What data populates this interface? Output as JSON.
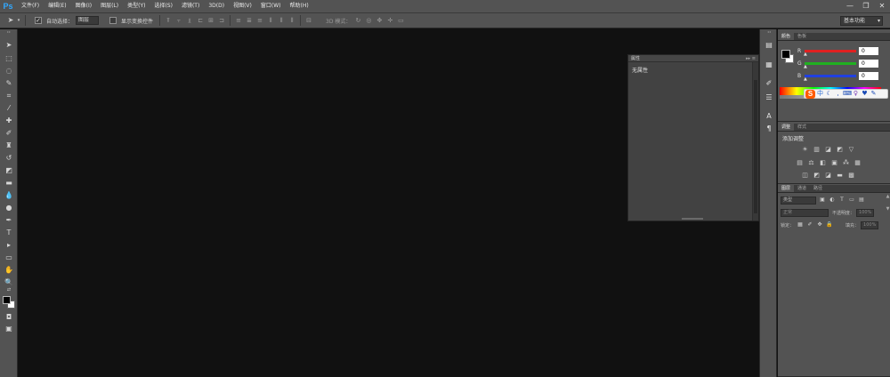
{
  "app": {
    "logo": "Ps"
  },
  "menubar": {
    "items": [
      "文件(F)",
      "编辑(E)",
      "图像(I)",
      "图层(L)",
      "类型(Y)",
      "选择(S)",
      "滤镜(T)",
      "3D(D)",
      "视图(V)",
      "窗口(W)",
      "帮助(H)"
    ],
    "window_controls": {
      "minimize": "—",
      "restore": "❐",
      "close": "✕"
    }
  },
  "options_bar": {
    "tool_icon": "move-tool-icon",
    "auto_select_label": "自动选择：",
    "auto_select_checked": true,
    "auto_select_value": "图层",
    "transform_controls_label": "显示变换控件",
    "transform_controls_checked": false,
    "mode_3d_label": "3D 模式：",
    "workspace": "基本功能"
  },
  "properties_panel": {
    "tab": "属性",
    "collapse": "▸▸",
    "menu": "≡",
    "content": "无属性"
  },
  "color_panel": {
    "tabs": [
      "颜色",
      "色板"
    ],
    "channels": [
      {
        "label": "R",
        "value": "0",
        "color": "#e02020"
      },
      {
        "label": "G",
        "value": "0",
        "color": "#20b020"
      },
      {
        "label": "B",
        "value": "0",
        "color": "#2040e0"
      }
    ],
    "foreground": "#000000",
    "background": "#ffffff"
  },
  "adjustments_panel": {
    "tabs": [
      "调整",
      "样式"
    ],
    "title": "添加调整"
  },
  "layers_panel": {
    "tabs": [
      "图层",
      "通道",
      "路径"
    ],
    "filter_label": "类型",
    "blend_mode": "正常",
    "opacity_label": "不透明度：",
    "opacity_value": "100%",
    "lock_label": "锁定：",
    "fill_label": "填充：",
    "fill_value": "100%"
  },
  "ime": {
    "logo": "S"
  },
  "dock": {
    "icons": [
      "history-icon",
      "adjust-icon",
      "brush-icon",
      "properties-icon",
      "character-icon",
      "paragraph-icon"
    ]
  }
}
